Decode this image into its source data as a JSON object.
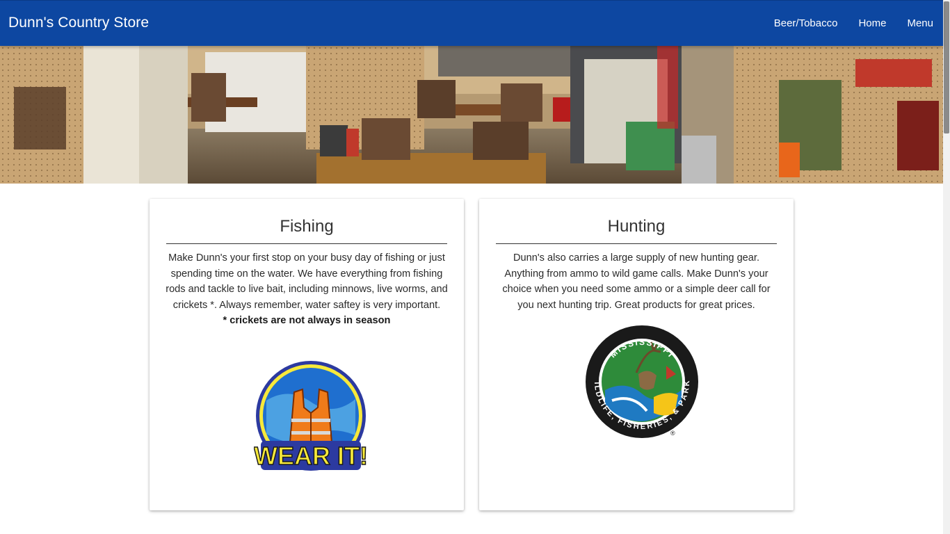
{
  "nav": {
    "brand": "Dunn's Country Store",
    "links": [
      "Beer/Tobacco",
      "Home",
      "Menu"
    ]
  },
  "cards": [
    {
      "title": "Fishing",
      "text": "Make Dunn's your first stop on your busy day of fishing or just spending time on the water. We have everything from fishing rods and tackle to live bait, including minnows, live worms, and crickets *. Always remember, water saftey is very important.",
      "note": "* crickets are not always in season",
      "logo": {
        "text": "WEAR IT!",
        "icon": "life-vest-icon"
      }
    },
    {
      "title": "Hunting",
      "text": "Dunn's also carries a large supply of new hunting gear. Anything from ammo to wild game calls. Make Dunn's your choice when you need some ammo or a simple deer call for you next hunting trip. Great products for great prices.",
      "logo": {
        "top_text": "MISSISSIPPI",
        "bottom_text": "WILDLIFE, FISHERIES, & PARKS",
        "registered": "®",
        "icon": "deer-icon"
      }
    }
  ],
  "colors": {
    "nav": "#0d47a1",
    "nav_text": "#ffffff"
  }
}
